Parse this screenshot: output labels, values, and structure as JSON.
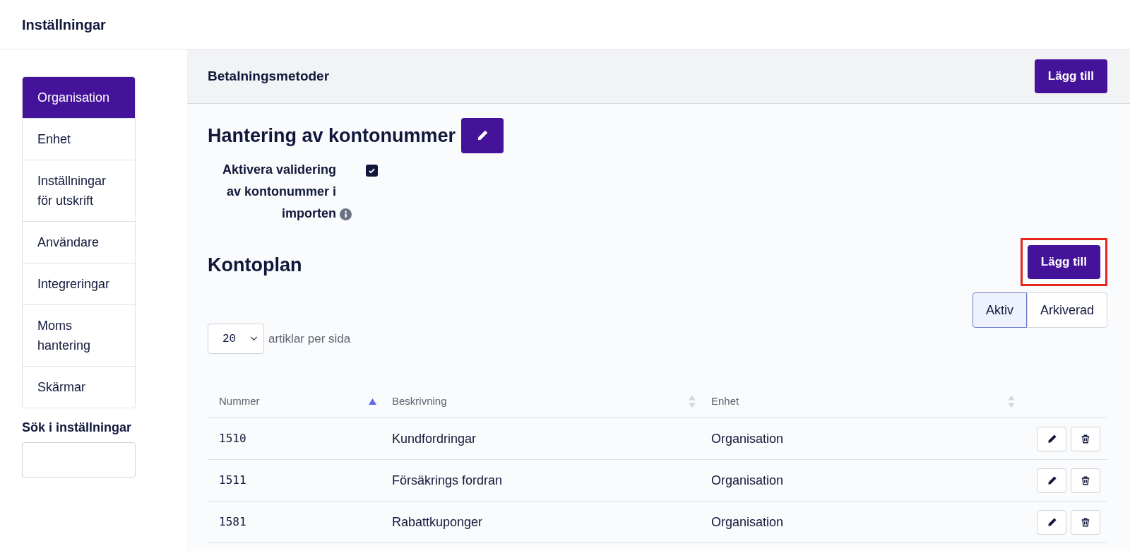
{
  "header": {
    "title": "Inställningar"
  },
  "sidebar": {
    "items": [
      {
        "label": "Organisation",
        "selected": true
      },
      {
        "label": "Enhet",
        "selected": false
      },
      {
        "label": "Inställningar för utskrift",
        "selected": false
      },
      {
        "label": "Användare",
        "selected": false
      },
      {
        "label": "Integreringar",
        "selected": false
      },
      {
        "label": "Moms hantering",
        "selected": false
      },
      {
        "label": "Skärmar",
        "selected": false
      }
    ],
    "search": {
      "label": "Sök i inställningar"
    }
  },
  "section_bar": {
    "title": "Betalningsmetoder",
    "button": {
      "label": "Lägg till",
      "highlighted": false
    }
  },
  "account_handling": {
    "title": "Hantering av kontonummer",
    "checkbox": {
      "label": "Aktivera validering av kontonummer i importen",
      "checked": true
    }
  },
  "chart_of_accounts": {
    "title": "Kontoplan",
    "button": {
      "label": "Lägg till",
      "highlighted": true
    },
    "filters": [
      {
        "label": "Aktiv",
        "selected": true
      },
      {
        "label": "Arkiverad",
        "selected": false
      }
    ],
    "page_size": {
      "value": "20",
      "label": "artiklar per sida"
    },
    "table": {
      "columns": [
        {
          "label": "Nummer",
          "sorted": true
        },
        {
          "label": "Beskrivning",
          "sorted": false
        },
        {
          "label": "Enhet",
          "sorted": false
        }
      ],
      "rows": [
        {
          "number": "1510",
          "description": "Kundfordringar",
          "unit": "Organisation"
        },
        {
          "number": "1511",
          "description": "Försäkrings fordran",
          "unit": "Organisation"
        },
        {
          "number": "1581",
          "description": "Rabattkuponger",
          "unit": "Organisation"
        }
      ]
    }
  }
}
